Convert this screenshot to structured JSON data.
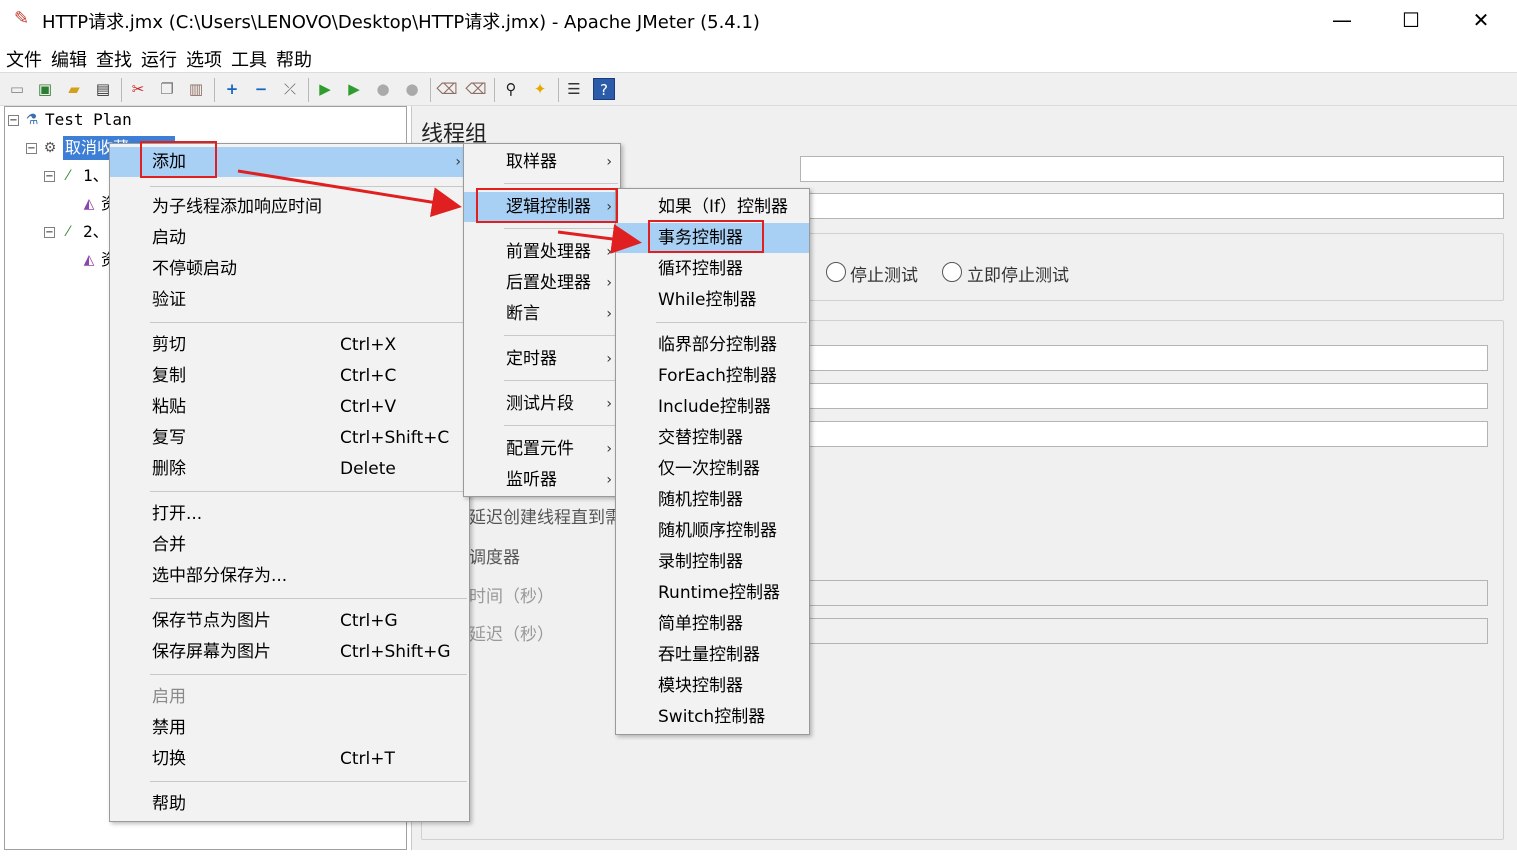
{
  "window": {
    "title": "HTTP请求.jmx (C:\\Users\\LENOVO\\Desktop\\HTTP请求.jmx) - Apache JMeter (5.4.1)",
    "minimize": "—",
    "maximize": "☐",
    "close": "✕"
  },
  "menubar": [
    "文件",
    "编辑",
    "查找",
    "运行",
    "选项",
    "工具",
    "帮助"
  ],
  "tree": {
    "root": "Test Plan",
    "thread_group": "取消收藏",
    "child1": "1、",
    "child2": "2、",
    "leaf": "资"
  },
  "panel": {
    "title": "线程组",
    "radio_stop_test": "停止测试",
    "radio_stop_now": "立即停止测试",
    "delay_label": "延迟创建线程直到需",
    "scheduler_label": "调度器",
    "duration_label": "时间（秒）",
    "startup_delay_label": "延迟（秒）"
  },
  "context_menu": {
    "add": "添加",
    "add_response_time": "为子线程添加响应时间",
    "start": "启动",
    "start_no_pause": "不停顿启动",
    "validate": "验证",
    "cut": "剪切",
    "cut_acc": "Ctrl+X",
    "copy": "复制",
    "copy_acc": "Ctrl+C",
    "paste": "粘贴",
    "paste_acc": "Ctrl+V",
    "duplicate": "复写",
    "duplicate_acc": "Ctrl+Shift+C",
    "delete": "删除",
    "delete_acc": "Delete",
    "open": "打开...",
    "merge": "合并",
    "save_selection": "选中部分保存为...",
    "save_node_image": "保存节点为图片",
    "save_node_image_acc": "Ctrl+G",
    "save_screen_image": "保存屏幕为图片",
    "save_screen_image_acc": "Ctrl+Shift+G",
    "enable": "启用",
    "disable": "禁用",
    "toggle": "切换",
    "toggle_acc": "Ctrl+T",
    "help": "帮助"
  },
  "add_submenu": {
    "sampler": "取样器",
    "logic_controller": "逻辑控制器",
    "pre_processor": "前置处理器",
    "post_processor": "后置处理器",
    "assertion": "断言",
    "timer": "定时器",
    "test_fragment": "测试片段",
    "config_element": "配置元件",
    "listener": "监听器"
  },
  "logic_submenu": [
    "如果（If）控制器",
    "事务控制器",
    "循环控制器",
    "While控制器",
    "临界部分控制器",
    "ForEach控制器",
    "Include控制器",
    "交替控制器",
    "仅一次控制器",
    "随机控制器",
    "随机顺序控制器",
    "录制控制器",
    "Runtime控制器",
    "简单控制器",
    "吞吐量控制器",
    "模块控制器",
    "Switch控制器"
  ],
  "colors": {
    "highlight": "#a8d0f5",
    "annotation": "#e02020"
  }
}
